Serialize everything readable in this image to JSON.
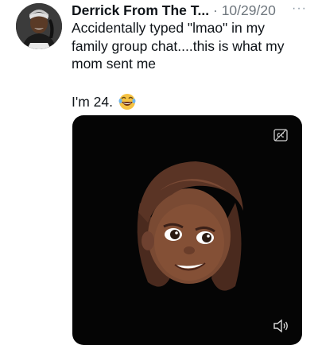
{
  "tweet": {
    "author_name": "Derrick From The T...",
    "separator": "·",
    "date": "10/29/20",
    "more_label": "···",
    "text": "Accidentally typed \"lmao\" in my family group chat....this is what my mom sent me",
    "text_2": "I'm 24.",
    "emoji_icon": "laughing-tears-emoji-icon"
  },
  "media": {
    "type": "video",
    "cc_icon": "closed-captions-icon",
    "volume_icon": "speaker-icon",
    "subject_icon": "memoji-avatar"
  },
  "colors": {
    "text": "#0f1419",
    "meta": "#6e767d",
    "media_bg": "#050505"
  }
}
